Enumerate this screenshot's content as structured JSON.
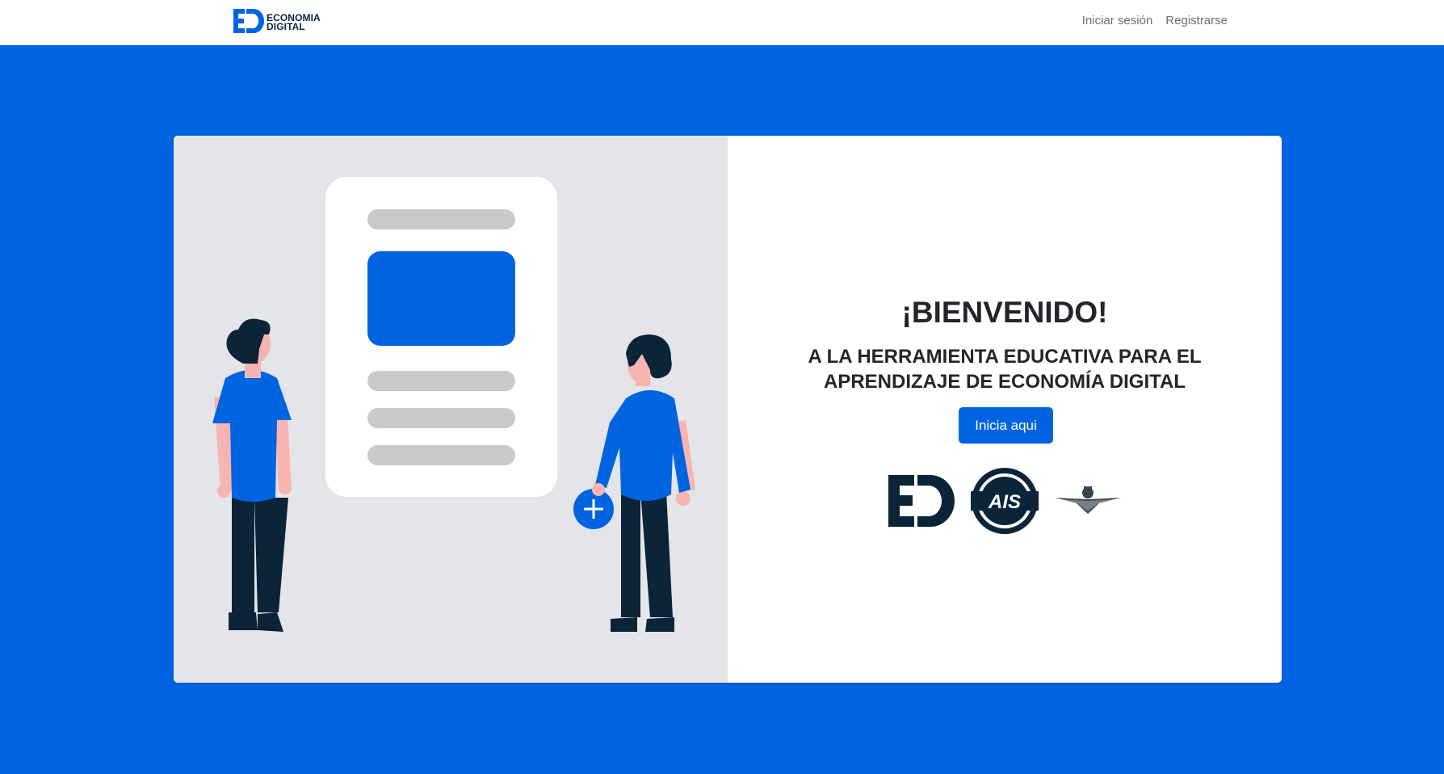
{
  "navbar": {
    "brand": {
      "line1": "ECONOMIA",
      "line2": "DIGITAL",
      "icon": "ed-logo-icon"
    },
    "links": [
      {
        "label": "Iniciar sesión"
      },
      {
        "label": "Registrarse"
      }
    ]
  },
  "hero": {
    "title": "¡BIENVENIDO!",
    "subtitle": "A LA HERRAMIENTA EDUCATIVA PARA EL APRENDIZAJE DE ECONOMÍA DIGITAL",
    "button_label": "Inicia aqui",
    "logos": [
      "ed-logo-icon",
      "ais-logo-icon",
      "winged-emblem-icon"
    ]
  },
  "colors": {
    "primary": "#0064e1",
    "dark": "#0b2438",
    "panel_gray": "#e3e5e8"
  }
}
